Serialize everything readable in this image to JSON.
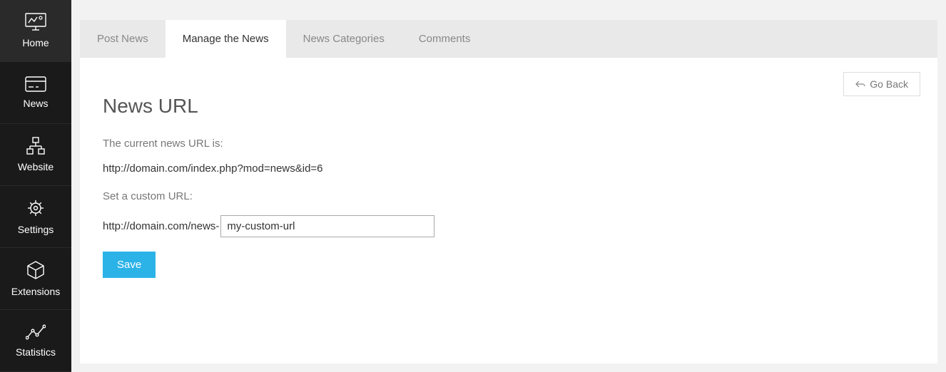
{
  "sidebar": {
    "items": [
      {
        "label": "Home"
      },
      {
        "label": "News"
      },
      {
        "label": "Website"
      },
      {
        "label": "Settings"
      },
      {
        "label": "Extensions"
      },
      {
        "label": "Statistics"
      }
    ]
  },
  "tabs": [
    {
      "label": "Post News"
    },
    {
      "label": "Manage the News"
    },
    {
      "label": "News Categories"
    },
    {
      "label": "Comments"
    }
  ],
  "buttons": {
    "go_back": "Go Back",
    "save": "Save"
  },
  "page": {
    "title": "News URL",
    "current_url_label": "The current news URL is:",
    "current_url": "http://domain.com/index.php?mod=news&id=6",
    "custom_label": "Set a custom URL:",
    "custom_prefix": "http://domain.com/news-",
    "custom_value": "my-custom-url"
  }
}
